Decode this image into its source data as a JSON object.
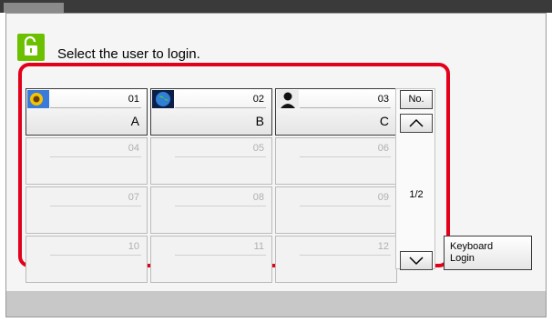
{
  "prompt": "Select the user to login.",
  "users": [
    {
      "num": "01",
      "name": "A",
      "active": true,
      "avatar": "sunflower-icon"
    },
    {
      "num": "02",
      "name": "B",
      "active": true,
      "avatar": "globe-icon"
    },
    {
      "num": "03",
      "name": "C",
      "active": true,
      "avatar": "person-silhouette-icon"
    },
    {
      "num": "04",
      "name": "",
      "active": false
    },
    {
      "num": "05",
      "name": "",
      "active": false
    },
    {
      "num": "06",
      "name": "",
      "active": false
    },
    {
      "num": "07",
      "name": "",
      "active": false
    },
    {
      "num": "08",
      "name": "",
      "active": false
    },
    {
      "num": "09",
      "name": "",
      "active": false
    },
    {
      "num": "10",
      "name": "",
      "active": false
    },
    {
      "num": "11",
      "name": "",
      "active": false
    },
    {
      "num": "12",
      "name": "",
      "active": false
    }
  ],
  "nav": {
    "no_label": "No.",
    "page_indicator": "1/2"
  },
  "keyboard_login": "Keyboard\nLogin",
  "colors": {
    "accent_green": "#6cc000",
    "highlight_red": "#e3001b"
  }
}
